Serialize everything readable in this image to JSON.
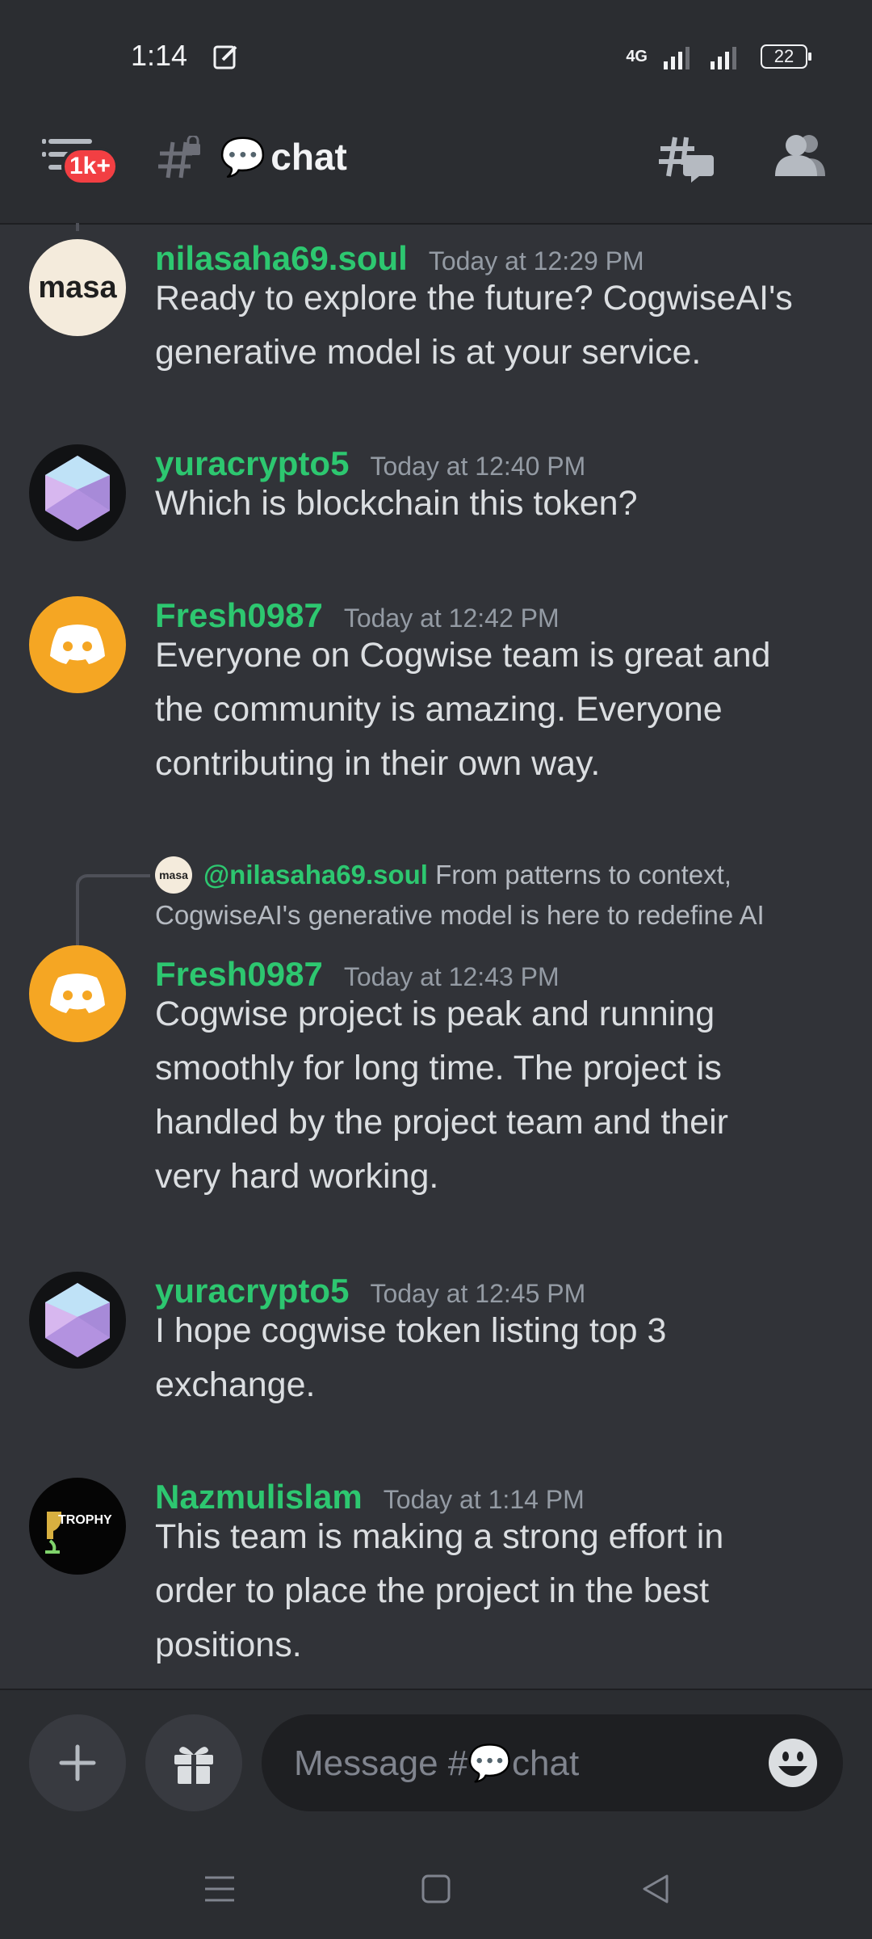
{
  "status_bar": {
    "time": "1:14",
    "network": "4G",
    "battery": "22"
  },
  "header": {
    "notification_badge": "1k+",
    "channel_emoji": "💬",
    "channel_name": "chat"
  },
  "messages": [
    {
      "username": "nilasaha69.soul",
      "timestamp": "Today at 12:29 PM",
      "avatar_text": "masa",
      "lines": [
        "Ready to explore the future? CogwiseAI's",
        "generative model is at your service."
      ]
    },
    {
      "username": "yuracrypto5",
      "timestamp": "Today at 12:40 PM",
      "lines": [
        "Which is blockchain this token?"
      ]
    },
    {
      "username": "Fresh0987",
      "timestamp": "Today at 12:42 PM",
      "lines": [
        "Everyone on Cogwise team is great and",
        "the community is amazing. Everyone",
        "contributing in their own way."
      ]
    },
    {
      "username": "Fresh0987",
      "timestamp": "Today at 12:43 PM",
      "reply": {
        "avatar_text": "masa",
        "mention": "@nilasaha69.soul",
        "text": "From patterns to context, CogwiseAI's generative model is here to redefine AI"
      },
      "lines": [
        "Cogwise project is peak and running",
        "smoothly for long time. The project is",
        "handled by the project team and their",
        "very hard working."
      ]
    },
    {
      "username": "yuracrypto5",
      "timestamp": "Today at 12:45 PM",
      "lines": [
        "I hope cogwise token listing top 3",
        "exchange."
      ]
    },
    {
      "username": "Nazmulislam",
      "timestamp": "Today at 1:14 PM",
      "avatar_text": "TROPHY",
      "lines": [
        "This team is making a strong effort in",
        "order to place the project in the best",
        "positions."
      ]
    }
  ],
  "composer": {
    "placeholder": "Message #💬chat"
  },
  "icons": {
    "menu": "hamburger-icon",
    "channel": "hashtag-lock-icon",
    "threads": "threads-icon",
    "members": "members-icon",
    "add": "plus-icon",
    "gift": "gift-icon",
    "emoji": "emoji-icon"
  },
  "colors": {
    "background": "#313338",
    "username": "#2dc770",
    "badge": "#f23f43",
    "discord_orange": "#f5a623"
  }
}
